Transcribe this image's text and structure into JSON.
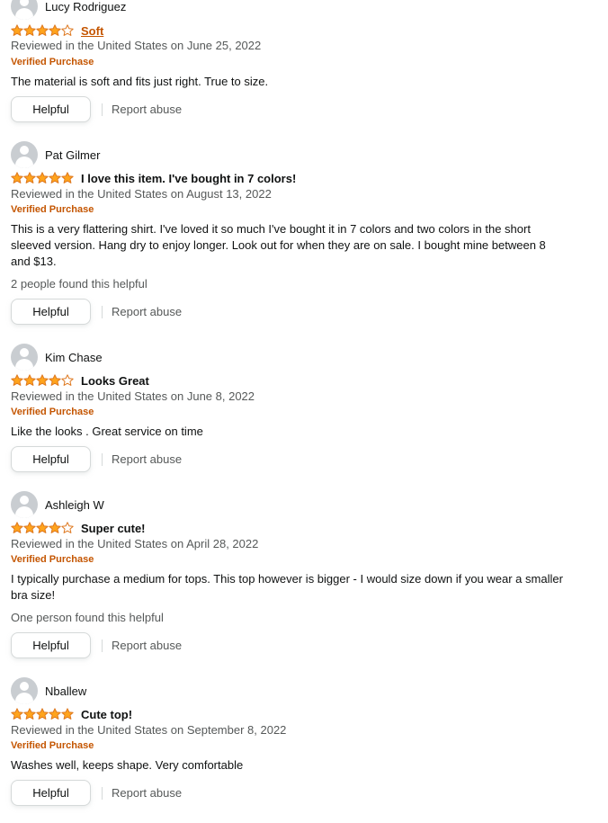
{
  "star_color": "#ffa41c",
  "star_outline_color": "#de7921",
  "reviews": [
    {
      "reviewer": "Lucy Rodriguez",
      "rating": 4,
      "title": "Soft",
      "date_line": "Reviewed in the United States on June 25, 2022",
      "verified": "Verified Purchase",
      "text": "The material is soft and fits just right. True to size.",
      "helpful_count": "",
      "helpful_label": "Helpful",
      "report_label": "Report abuse"
    },
    {
      "reviewer": "Pat Gilmer",
      "rating": 5,
      "title": "I love this item. I've bought in 7 colors!",
      "date_line": "Reviewed in the United States on August 13, 2022",
      "verified": "Verified Purchase",
      "text": "This is a very flattering shirt. I've loved it so much I've bought it in 7 colors and two colors in the short sleeved version. Hang dry to enjoy longer. Look out for when they are on sale. I bought mine between 8 and $13.",
      "helpful_count": "2 people found this helpful",
      "helpful_label": "Helpful",
      "report_label": "Report abuse"
    },
    {
      "reviewer": "Kim Chase",
      "rating": 4,
      "title": "Looks Great",
      "date_line": "Reviewed in the United States on June 8, 2022",
      "verified": "Verified Purchase",
      "text": "Like the looks . Great service on time",
      "helpful_count": "",
      "helpful_label": "Helpful",
      "report_label": "Report abuse"
    },
    {
      "reviewer": "Ashleigh W",
      "rating": 4,
      "title": "Super cute!",
      "date_line": "Reviewed in the United States on April 28, 2022",
      "verified": "Verified Purchase",
      "text": "I typically purchase a medium for tops. This top however is bigger - I would size down if you wear a smaller bra size!",
      "helpful_count": "One person found this helpful",
      "helpful_label": "Helpful",
      "report_label": "Report abuse"
    },
    {
      "reviewer": "Nballew",
      "rating": 5,
      "title": "Cute top!",
      "date_line": "Reviewed in the United States on September 8, 2022",
      "verified": "Verified Purchase",
      "text": "Washes well, keeps shape. Very comfortable",
      "helpful_count": "",
      "helpful_label": "Helpful",
      "report_label": "Report abuse"
    }
  ]
}
